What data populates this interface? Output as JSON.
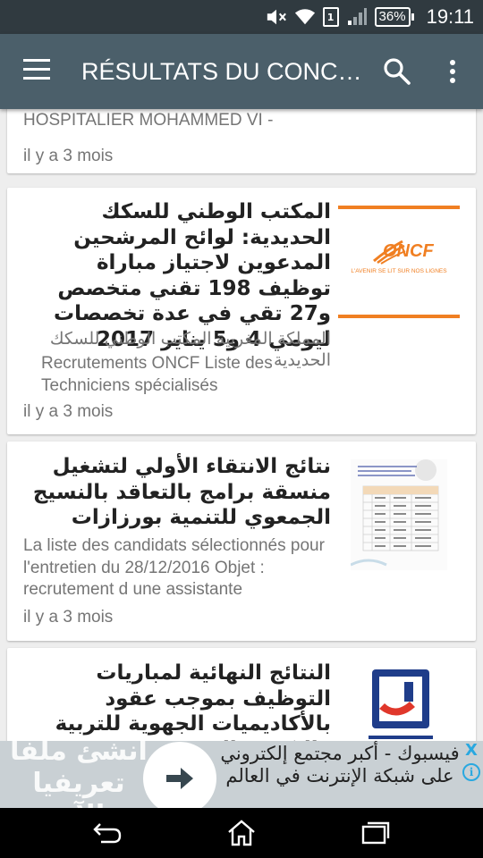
{
  "status_bar": {
    "sim_label": "1",
    "battery": "36%",
    "time": "19:11",
    "icons": [
      "mute-icon",
      "wifi-icon",
      "sim-icon",
      "signal-icon",
      "battery-icon"
    ]
  },
  "toolbar": {
    "title": "RÉSULTATS DU CONCOURS",
    "icons": [
      "menu-icon",
      "search-icon",
      "more-vert-icon"
    ]
  },
  "cards": [
    {
      "desc": "DE LA SANTE CENTRE HOSPITALIER MOHAMMED VI -",
      "time": "il y a 3 mois"
    },
    {
      "title": "المكتب الوطني للسكك الحديدية: لوائح المرشحين المدعوين لاجتياز مباراة توظيف 198 تقني متخصص و27 تقي في عدة تخصصات ليومي 4 و5 يناير 2017",
      "desc_ar": "المملكة المغربية المكتب الوطني للسكك الحديدية",
      "desc_fr": "Recrutements ONCF Liste des Techniciens spécialisés",
      "time": "il y a 3 mois",
      "thumb_brand": "ONCF",
      "thumb_slogan": "L'AVENIR SE LIT SUR NOS LIGNES"
    },
    {
      "title": "نتائج الانتقاء الأولي لتشغيل منسقة برامج بالتعاقد بالنسيج الجمعوي للتنمية بورزازات",
      "desc": "La liste des candidats sélectionnés pour l'entretien du 28/12/2016 Objet : recrutement d une assistante",
      "time": "il y a 3 mois"
    },
    {
      "title": "النتائج النهائية لمباريات التوظيف بموجب عقود بالأكاديميات الجهوية للتربية والتكوين الجهوية"
    }
  ],
  "ad": {
    "left_text": "انشئ ملفا تعريفيا الآن",
    "right_text": "فيسبوك - أكبر مجتمع إلكتروني على شبكة الإنترنت في العالم",
    "close": "X",
    "info": "i"
  },
  "navbar": {
    "icons": [
      "back-icon",
      "home-icon",
      "recents-icon"
    ]
  },
  "colors": {
    "status_bar": "#303a40",
    "toolbar": "#4b5f6a",
    "oncf_orange": "#f07f22",
    "ad_accent": "#29a8e0"
  }
}
